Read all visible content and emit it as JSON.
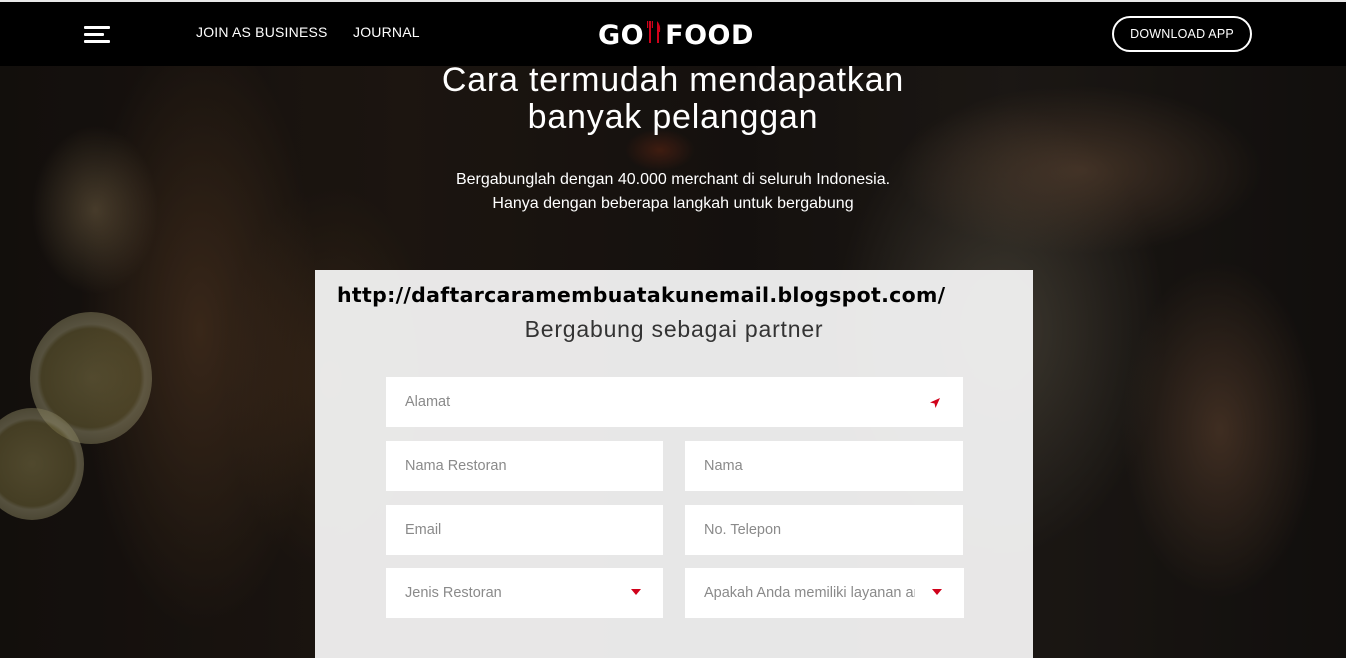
{
  "nav": {
    "menu_icon": "hamburger-menu-icon",
    "join_label": "JOIN AS BUSINESS",
    "journal_label": "JOURNAL",
    "logo": {
      "left": "GO",
      "right": "FOOD",
      "icon": "fork-knife-icon"
    },
    "download_label": "DOWNLOAD APP"
  },
  "hero": {
    "title": "Cara termudah mendapatkan\nbanyak pelanggan",
    "subtitle": "Bergabunglah dengan 40.000 merchant di seluruh Indonesia.\nHanya dengan beberapa langkah untuk bergabung"
  },
  "form": {
    "watermark": "http://daftarcaramembuatakunemail.blogspot.com/",
    "title": "Bergabung sebagai partner",
    "alamat_placeholder": "Alamat",
    "restoran_placeholder": "Nama Restoran",
    "nama_placeholder": "Nama",
    "email_placeholder": "Email",
    "telepon_placeholder": "No. Telepon",
    "jenis_label": "Jenis Restoran",
    "layanan_label": "Apakah Anda memiliki layanan ar"
  },
  "colors": {
    "accent": "#d0021b",
    "nav_bg": "#000000",
    "card_bg": "#f0f0f0"
  }
}
